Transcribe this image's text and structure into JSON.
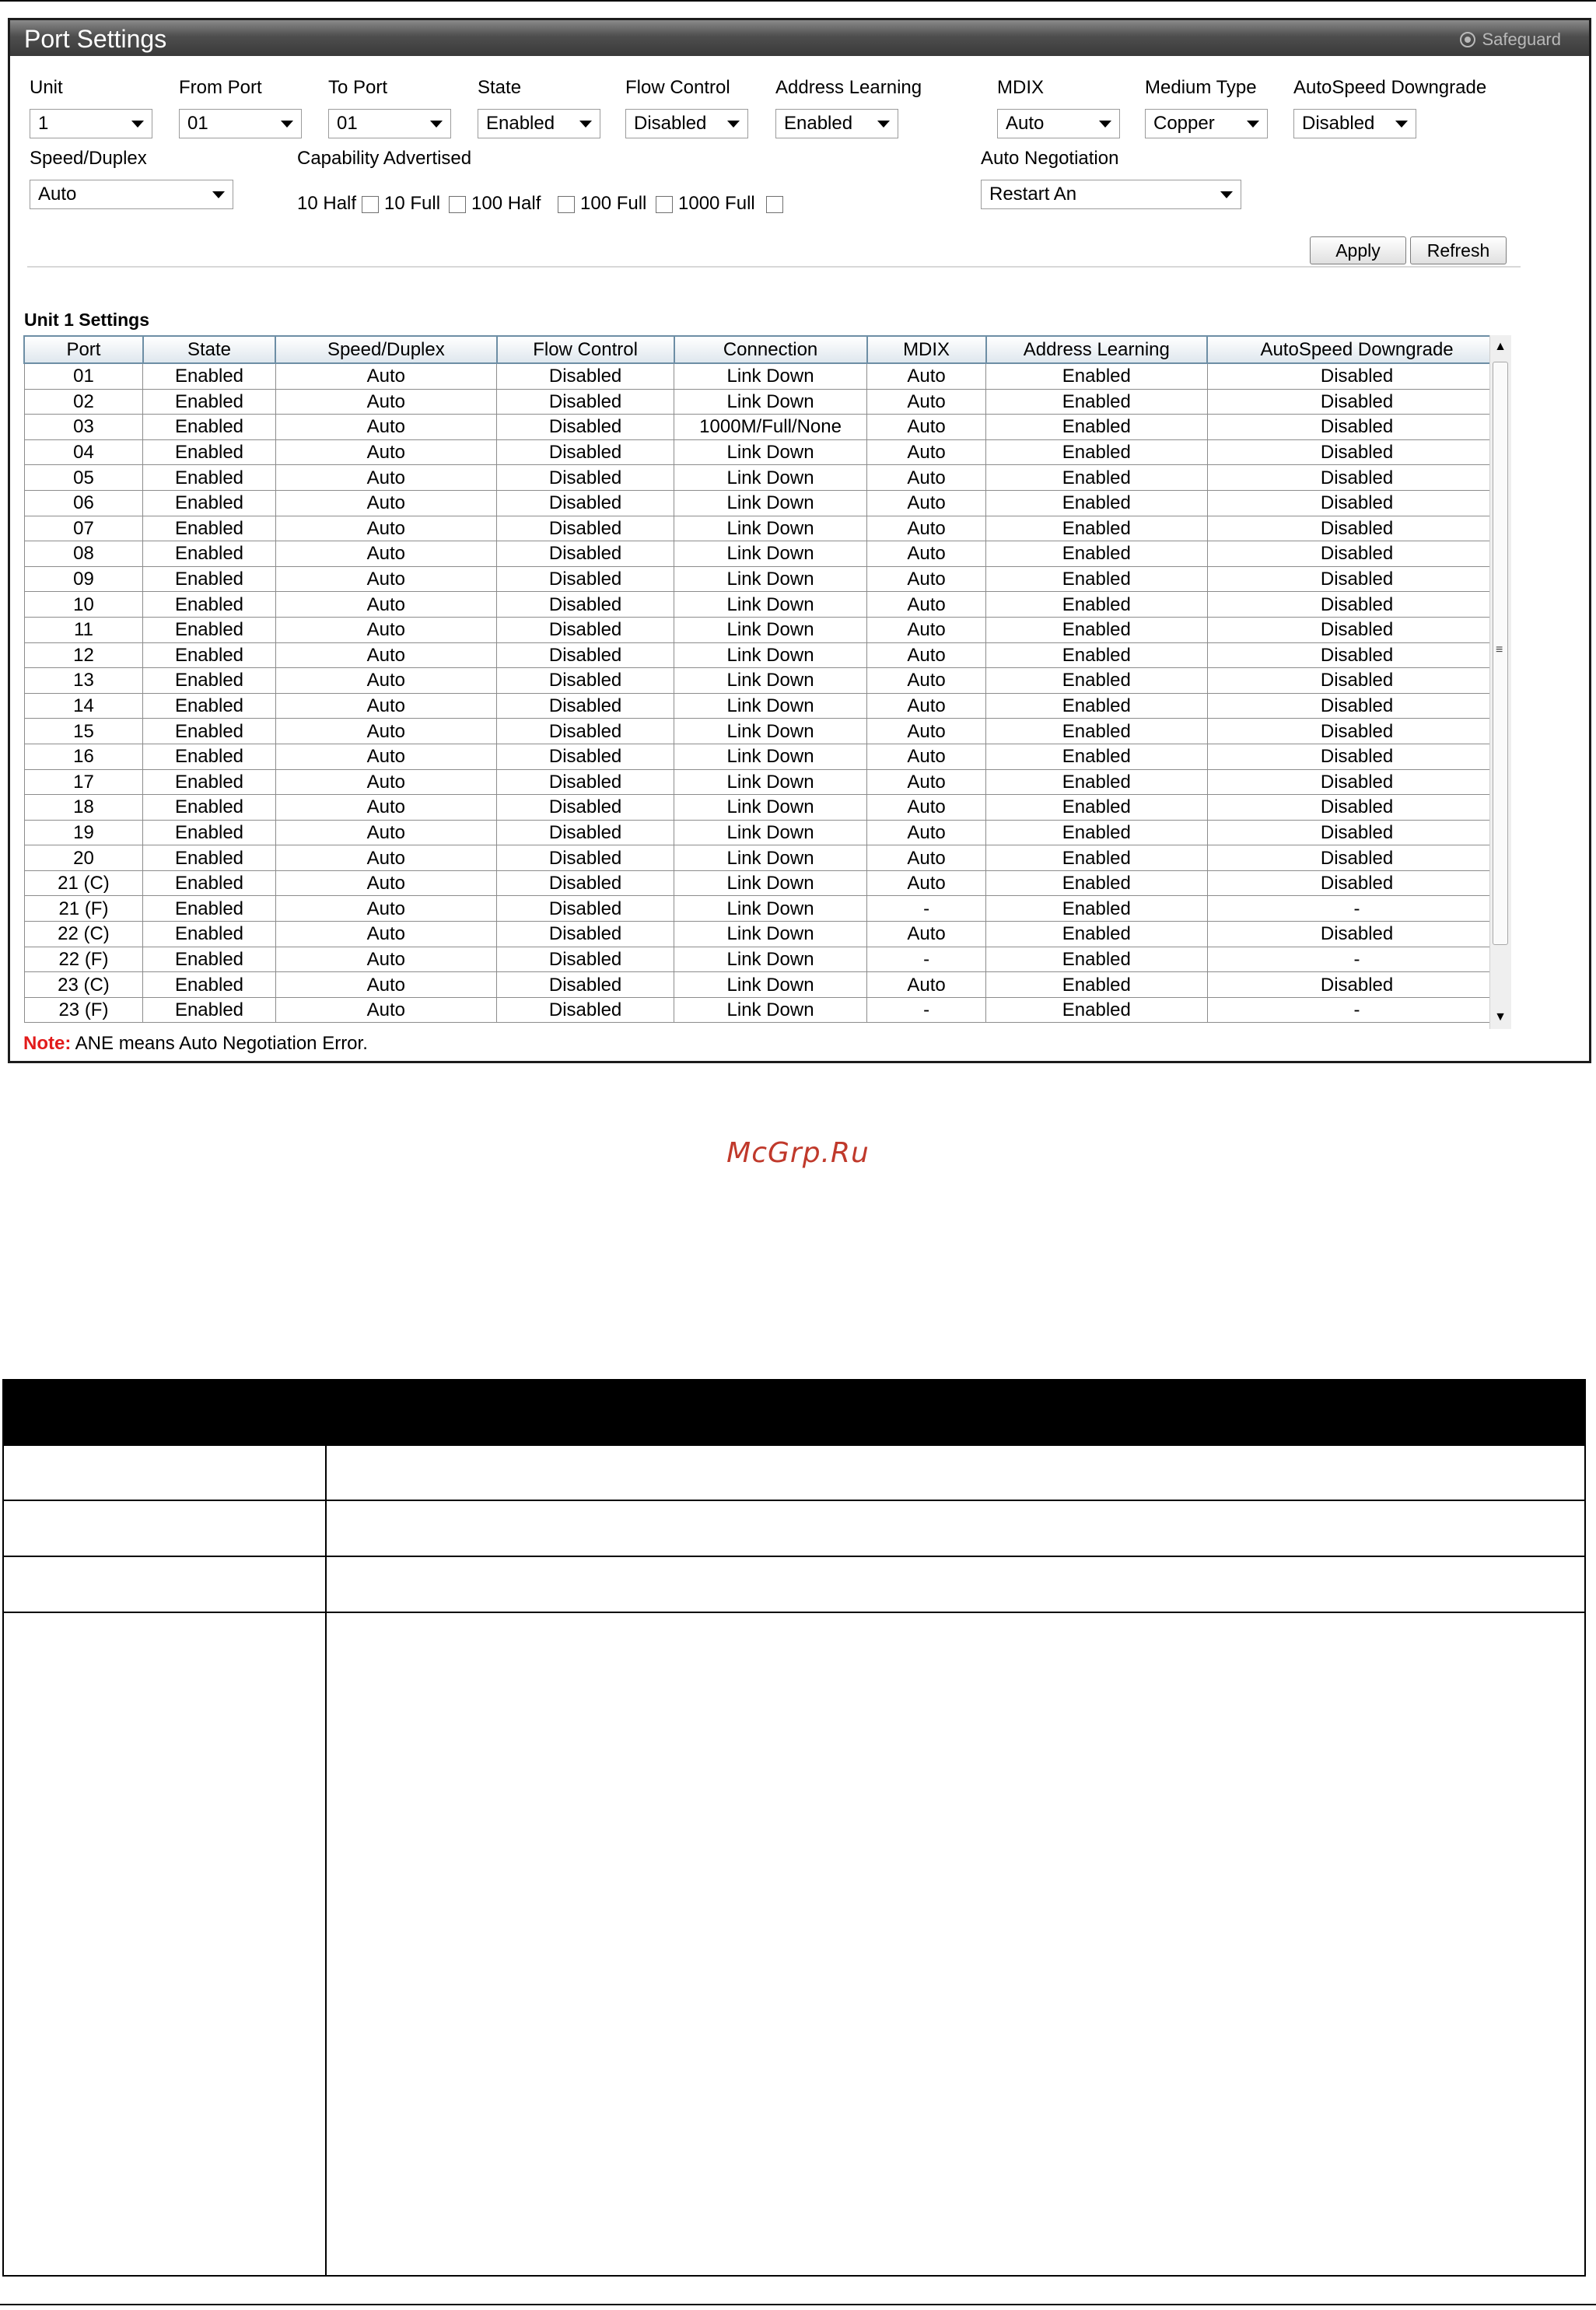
{
  "window": {
    "title": "Port Settings",
    "safeguard": "Safeguard"
  },
  "form": {
    "unit": {
      "label": "Unit",
      "value": "1"
    },
    "from_port": {
      "label": "From Port",
      "value": "01"
    },
    "to_port": {
      "label": "To Port",
      "value": "01"
    },
    "state": {
      "label": "State",
      "value": "Enabled"
    },
    "flow_control": {
      "label": "Flow Control",
      "value": "Disabled"
    },
    "address_learning": {
      "label": "Address Learning",
      "value": "Enabled"
    },
    "mdix": {
      "label": "MDIX",
      "value": "Auto"
    },
    "medium_type": {
      "label": "Medium Type",
      "value": "Copper"
    },
    "autospeed_downgrade": {
      "label": "AutoSpeed Downgrade",
      "value": "Disabled"
    },
    "speed_duplex": {
      "label": "Speed/Duplex",
      "value": "Auto"
    },
    "capability": {
      "label": "Capability Advertised",
      "options": [
        "10 Half",
        "10 Full",
        "100 Half",
        "100 Full",
        "1000 Full"
      ]
    },
    "auto_negotiation": {
      "label": "Auto Negotiation",
      "value": "Restart An"
    },
    "apply_label": "Apply",
    "refresh_label": "Refresh"
  },
  "table": {
    "title": "Unit 1 Settings",
    "columns": [
      "Port",
      "State",
      "Speed/Duplex",
      "Flow Control",
      "Connection",
      "MDIX",
      "Address Learning",
      "AutoSpeed Downgrade"
    ],
    "rows": [
      [
        "01",
        "Enabled",
        "Auto",
        "Disabled",
        "Link Down",
        "Auto",
        "Enabled",
        "Disabled"
      ],
      [
        "02",
        "Enabled",
        "Auto",
        "Disabled",
        "Link Down",
        "Auto",
        "Enabled",
        "Disabled"
      ],
      [
        "03",
        "Enabled",
        "Auto",
        "Disabled",
        "1000M/Full/None",
        "Auto",
        "Enabled",
        "Disabled"
      ],
      [
        "04",
        "Enabled",
        "Auto",
        "Disabled",
        "Link Down",
        "Auto",
        "Enabled",
        "Disabled"
      ],
      [
        "05",
        "Enabled",
        "Auto",
        "Disabled",
        "Link Down",
        "Auto",
        "Enabled",
        "Disabled"
      ],
      [
        "06",
        "Enabled",
        "Auto",
        "Disabled",
        "Link Down",
        "Auto",
        "Enabled",
        "Disabled"
      ],
      [
        "07",
        "Enabled",
        "Auto",
        "Disabled",
        "Link Down",
        "Auto",
        "Enabled",
        "Disabled"
      ],
      [
        "08",
        "Enabled",
        "Auto",
        "Disabled",
        "Link Down",
        "Auto",
        "Enabled",
        "Disabled"
      ],
      [
        "09",
        "Enabled",
        "Auto",
        "Disabled",
        "Link Down",
        "Auto",
        "Enabled",
        "Disabled"
      ],
      [
        "10",
        "Enabled",
        "Auto",
        "Disabled",
        "Link Down",
        "Auto",
        "Enabled",
        "Disabled"
      ],
      [
        "11",
        "Enabled",
        "Auto",
        "Disabled",
        "Link Down",
        "Auto",
        "Enabled",
        "Disabled"
      ],
      [
        "12",
        "Enabled",
        "Auto",
        "Disabled",
        "Link Down",
        "Auto",
        "Enabled",
        "Disabled"
      ],
      [
        "13",
        "Enabled",
        "Auto",
        "Disabled",
        "Link Down",
        "Auto",
        "Enabled",
        "Disabled"
      ],
      [
        "14",
        "Enabled",
        "Auto",
        "Disabled",
        "Link Down",
        "Auto",
        "Enabled",
        "Disabled"
      ],
      [
        "15",
        "Enabled",
        "Auto",
        "Disabled",
        "Link Down",
        "Auto",
        "Enabled",
        "Disabled"
      ],
      [
        "16",
        "Enabled",
        "Auto",
        "Disabled",
        "Link Down",
        "Auto",
        "Enabled",
        "Disabled"
      ],
      [
        "17",
        "Enabled",
        "Auto",
        "Disabled",
        "Link Down",
        "Auto",
        "Enabled",
        "Disabled"
      ],
      [
        "18",
        "Enabled",
        "Auto",
        "Disabled",
        "Link Down",
        "Auto",
        "Enabled",
        "Disabled"
      ],
      [
        "19",
        "Enabled",
        "Auto",
        "Disabled",
        "Link Down",
        "Auto",
        "Enabled",
        "Disabled"
      ],
      [
        "20",
        "Enabled",
        "Auto",
        "Disabled",
        "Link Down",
        "Auto",
        "Enabled",
        "Disabled"
      ],
      [
        "21 (C)",
        "Enabled",
        "Auto",
        "Disabled",
        "Link Down",
        "Auto",
        "Enabled",
        "Disabled"
      ],
      [
        "21 (F)",
        "Enabled",
        "Auto",
        "Disabled",
        "Link Down",
        "-",
        "Enabled",
        "-"
      ],
      [
        "22 (C)",
        "Enabled",
        "Auto",
        "Disabled",
        "Link Down",
        "Auto",
        "Enabled",
        "Disabled"
      ],
      [
        "22 (F)",
        "Enabled",
        "Auto",
        "Disabled",
        "Link Down",
        "-",
        "Enabled",
        "-"
      ],
      [
        "23 (C)",
        "Enabled",
        "Auto",
        "Disabled",
        "Link Down",
        "Auto",
        "Enabled",
        "Disabled"
      ],
      [
        "23 (F)",
        "Enabled",
        "Auto",
        "Disabled",
        "Link Down",
        "-",
        "Enabled",
        "-"
      ]
    ]
  },
  "note": {
    "label": "Note:",
    "text": " ANE means Auto Negotiation Error."
  },
  "watermark": "McGrp.Ru",
  "colors": {
    "title_bar": "#4e4e4e",
    "table_header_border": "#6d8ea5",
    "note_label": "#e21b1b",
    "watermark": "#c0392b"
  }
}
